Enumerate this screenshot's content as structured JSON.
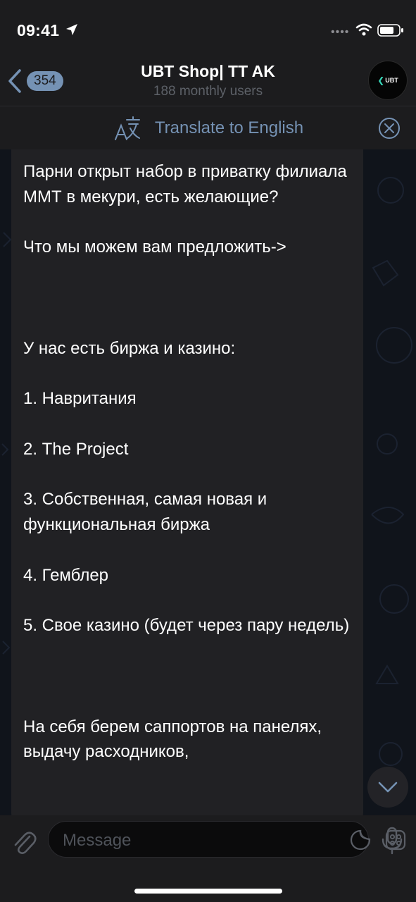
{
  "status_bar": {
    "time": "09:41"
  },
  "header": {
    "back_count": "354",
    "title": "UBT Shop| TT AK",
    "subtitle": "188 monthly users",
    "avatar_text": "UBT"
  },
  "translate_bar": {
    "label": "Translate to English"
  },
  "message": {
    "text": "Парни открыт набор в приватку филиала ММТ в мекури, есть желающие?\n\nЧто мы можем вам предложить->\n\n\n\nУ нас есть биржа и казино:\n\n1. Навритания\n\n2. The Project\n\n3. Собственная, самая новая и функциональная биржа\n\n4. Гемблер\n\n5. Свое казино (будет через пару недель)\n\n\n\nНа себя берем саппортов на панелях, выдачу расходников,"
  },
  "input_bar": {
    "placeholder": "Message"
  },
  "colors": {
    "accent": "#7592b4",
    "background": "#1c1c1e",
    "bubble": "#212124",
    "avatar_accent": "#36d6b8"
  },
  "icons": {
    "location": "location-arrow-icon",
    "wifi": "wifi-icon",
    "battery": "battery-icon",
    "back": "chevron-left-icon",
    "translate": "translate-icon",
    "close": "close-circle-icon",
    "scroll_down": "chevron-down-icon",
    "attach": "paperclip-icon",
    "sticker": "sticker-icon",
    "commands": "bot-commands-icon",
    "mic": "microphone-icon"
  }
}
